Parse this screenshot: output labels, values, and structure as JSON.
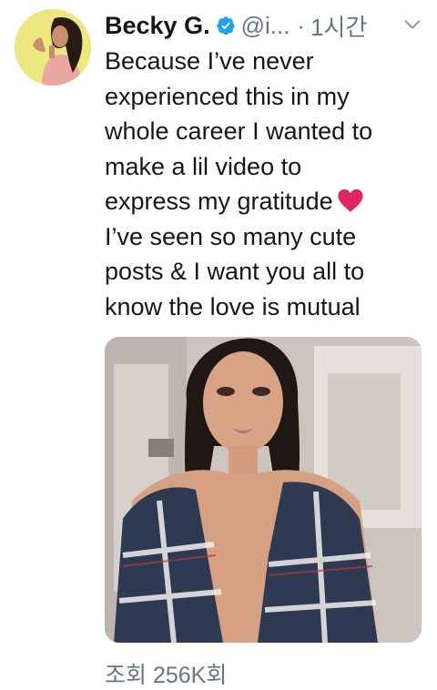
{
  "tweet": {
    "author_name": "Becky G.",
    "handle": "@i...",
    "separator": "·",
    "time": "1시간",
    "text_lines": [
      "Because I’ve never",
      "experienced this in my",
      "whole career I wanted to",
      "make a lil video to",
      "express my gratitude",
      "I’ve seen so many cute",
      "posts & I want you all to",
      "know the love is mutual"
    ],
    "views": "조회 256K회"
  },
  "icons": {
    "verified": "verified-badge-icon",
    "heart": "red-heart-emoji",
    "menu": "chevron-down-icon"
  },
  "colors": {
    "text": "#14171a",
    "secondary": "#657786",
    "verified": "#1da1f2",
    "heart": "#e0245e"
  }
}
